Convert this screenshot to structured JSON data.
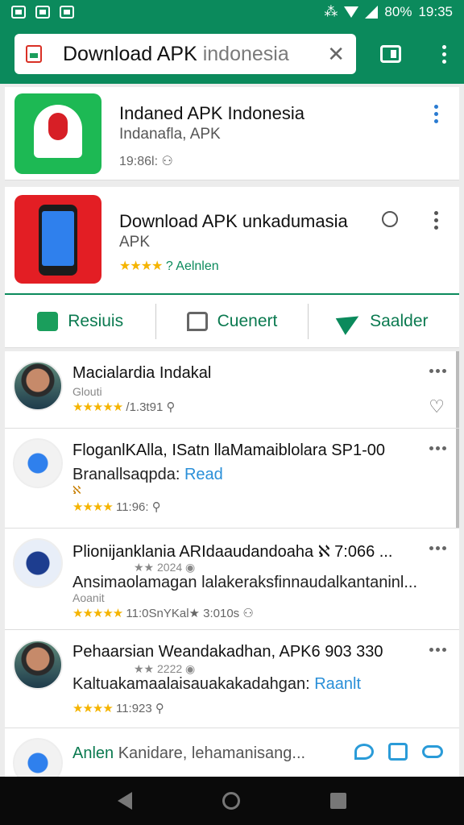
{
  "status_bar": {
    "battery": "80%",
    "time": "19:35"
  },
  "toolbar": {
    "url_main": "Download APK",
    "url_muted": " indonesia",
    "clear": "✕"
  },
  "apps": [
    {
      "title": "Indaned APK Indonesia",
      "subtitle": "Indanafla, APK",
      "meta": "19:86l: ⚇"
    },
    {
      "title": "Download APK unkadumasia",
      "subtitle": "APK",
      "stars": "★★★★",
      "meta": " ? Aelnlen"
    }
  ],
  "actions": [
    {
      "label": "Resiuis"
    },
    {
      "label": "Cuenert"
    },
    {
      "label": "Saalder"
    }
  ],
  "reviews": [
    {
      "name": "Macialardia Indakal",
      "sub": "Glouti",
      "stars": "★★★★★",
      "meta": " /1.3t91 ⚲"
    },
    {
      "name": "FloganlKAlla, ISatn llaMamaiblolara SP1-00",
      "body": "Branallsaqpda: ",
      "link": "Read",
      "extra": "ℵ",
      "stars": "★★★★",
      "meta": " 11:96: ⚲"
    },
    {
      "name": "Plionijanklania ARIdaaudandoaha ℵ 7:066 ...",
      "sub": "★★ 2024 ◉",
      "body": "Ansimaolamagan lalakeraksfinnaudalkantaninl...",
      "small": "Aoanit",
      "stars": "★★★★★",
      "meta": " 11:0SnYKal★ 3:010s ⚇"
    },
    {
      "name": "Pehaarsian Weandakadhan, APK6 903 330",
      "sub": "★★ 2222 ◉",
      "body": "Kaltuakamaalaisauakakadahgan: ",
      "link": "Raanlt",
      "stars": "★★★★",
      "meta": " 11:923 ⚲"
    },
    {
      "name": "Anlen",
      "name_rest": " Kanidare, lehamanisang..."
    }
  ]
}
